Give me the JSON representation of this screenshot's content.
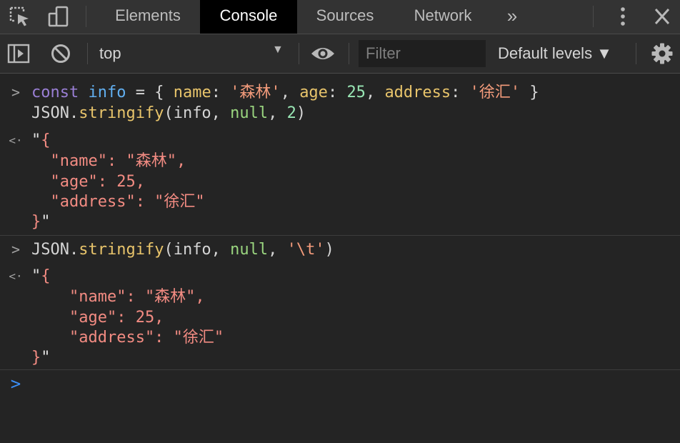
{
  "tabs": {
    "elements": "Elements",
    "console": "Console",
    "sources": "Sources",
    "network": "Network",
    "more": "»"
  },
  "toolbar": {
    "context": "top",
    "filter_placeholder": "Filter",
    "levels": "Default levels ▼"
  },
  "entries": [
    {
      "kind": "input",
      "lines": [
        "const info = { name: '森林', age: 25, address: '徐汇' }",
        "JSON.stringify(info, null, 2)"
      ]
    },
    {
      "kind": "output",
      "lines": [
        "\"{",
        "  \"name\": \"森林\",",
        "  \"age\": 25,",
        "  \"address\": \"徐汇\"",
        "}\""
      ]
    },
    {
      "kind": "input",
      "lines": [
        "JSON.stringify(info, null, '\\t')"
      ]
    },
    {
      "kind": "output",
      "lines": [
        "\"{",
        "\t\"name\": \"森林\",",
        "\t\"age\": 25,",
        "\t\"address\": \"徐汇\"",
        "}\""
      ]
    }
  ],
  "prompt_symbols": {
    "input": ">",
    "output": "<·",
    "active": ">"
  },
  "colors": {
    "keyword": "#9a7fd5",
    "variable": "#61aff0",
    "function": "#e8c46b",
    "string": "#f39b7b",
    "number": "#99e6b4",
    "null": "#9ad57f",
    "result_text": "#f28b82",
    "active_prompt": "#3b8ef6"
  }
}
